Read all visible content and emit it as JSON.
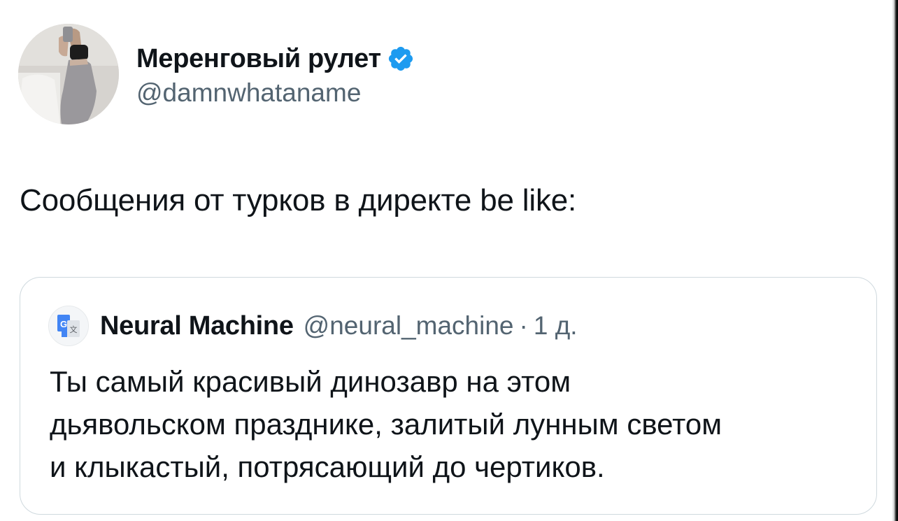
{
  "author": {
    "display_name": "Меренговый рулет",
    "handle": "@damnwhataname",
    "verified_icon": "verified-badge-icon",
    "avatar": "profile-photo-avatar"
  },
  "tweet": {
    "text": "Сообщения от турков в директе be like:"
  },
  "quoted_tweet": {
    "author": {
      "display_name": "Neural Machine",
      "handle": "@neural_machine",
      "avatar_icon": "translate-app-icon"
    },
    "separator": "·",
    "time": "1 д.",
    "lines": [
      "Ты самый красивый динозавр на этом",
      "дьявольском празднике, залитый лунным светом",
      "и клыкастый, потрясающий до чертиков."
    ]
  },
  "colors": {
    "text_primary": "#0f1419",
    "text_secondary": "#536471",
    "verified_blue": "#1d9bf0",
    "border": "#cfd9de"
  }
}
